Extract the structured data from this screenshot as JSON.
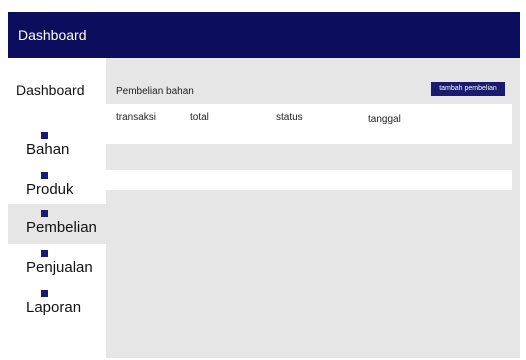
{
  "header": {
    "title": "Dashboard",
    "color": "#0d0d5e"
  },
  "sidebar": {
    "home_label": "Dashboard",
    "items": [
      {
        "label": "Bahan",
        "icon": "square-bullet-icon"
      },
      {
        "label": "Produk",
        "icon": "square-bullet-icon"
      },
      {
        "label": "Pembelian",
        "icon": "square-bullet-icon",
        "active": true
      },
      {
        "label": "Penjualan",
        "icon": "square-bullet-icon"
      },
      {
        "label": "Laporan",
        "icon": "square-bullet-icon"
      }
    ]
  },
  "main": {
    "section_title": "Pembelian bahan",
    "add_button_label": "tambah pembelian",
    "table": {
      "columns": [
        "transaksi",
        "total",
        "status",
        "tanggal"
      ],
      "rows": []
    }
  },
  "colors": {
    "accent": "#1a1a6e",
    "content_bg": "#e6e6e6"
  }
}
